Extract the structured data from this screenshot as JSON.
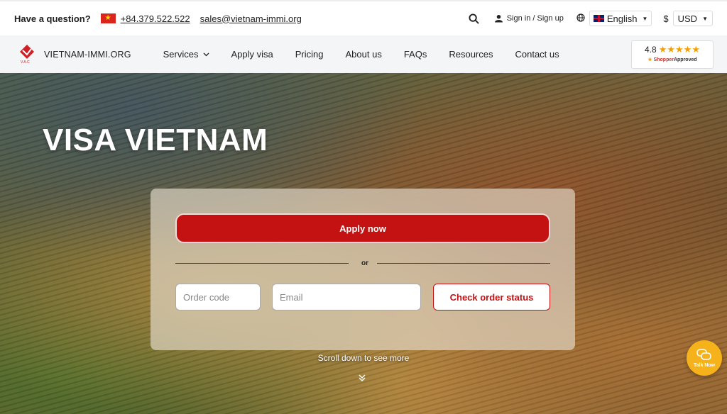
{
  "topbar": {
    "question": "Have a question?",
    "phone": "+84.379.522.522",
    "email": "sales@vietnam-immi.org",
    "signin": "Sign in / Sign up",
    "language": "English",
    "currency_symbol": "$",
    "currency": "USD"
  },
  "nav": {
    "brand": "VIETNAM-IMMI.ORG",
    "logo_caption": "V.A.C",
    "items": [
      "Services",
      "Apply visa",
      "Pricing",
      "About us",
      "FAQs",
      "Resources",
      "Contact us"
    ]
  },
  "rating": {
    "score": "4.8",
    "stars": "★★★★★",
    "provider_a": "Shopper",
    "provider_b": "Approved"
  },
  "hero": {
    "title": "VISA VIETNAM",
    "apply_label": "Apply now",
    "or_label": "or",
    "order_placeholder": "Order code",
    "email_placeholder": "Email",
    "check_label": "Check order status",
    "scroll_hint": "Scroll down to see more"
  },
  "chat": {
    "label": "Talk Now"
  },
  "colors": {
    "accent": "#c41212",
    "chat": "#f5b21b"
  }
}
